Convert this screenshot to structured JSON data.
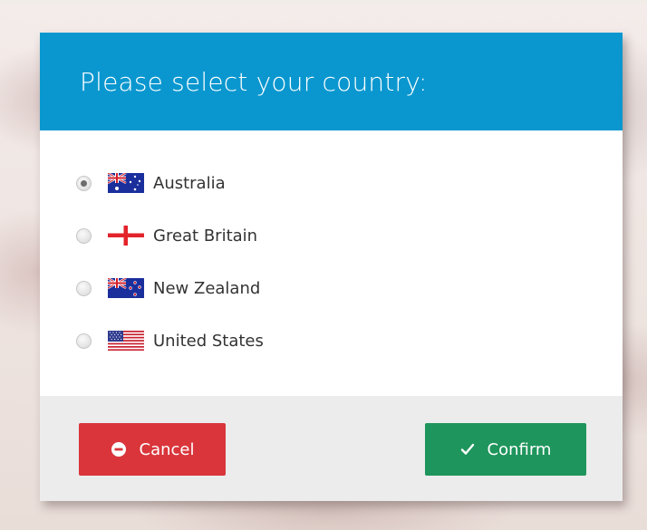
{
  "dialog": {
    "title": "Please select your country:",
    "header_color": "#0a97cf"
  },
  "countries": [
    {
      "label": "Australia",
      "flag": "australia-flag-icon",
      "selected": true
    },
    {
      "label": "Great Britain",
      "flag": "england-flag-icon",
      "selected": false
    },
    {
      "label": "New Zealand",
      "flag": "new-zealand-flag-icon",
      "selected": false
    },
    {
      "label": "United States",
      "flag": "usa-flag-icon",
      "selected": false
    }
  ],
  "buttons": {
    "cancel_label": "Cancel",
    "cancel_icon": "minus-circle-icon",
    "cancel_color": "#d9353b",
    "confirm_label": "Confirm",
    "confirm_icon": "checkmark-icon",
    "confirm_color": "#1e955c"
  }
}
